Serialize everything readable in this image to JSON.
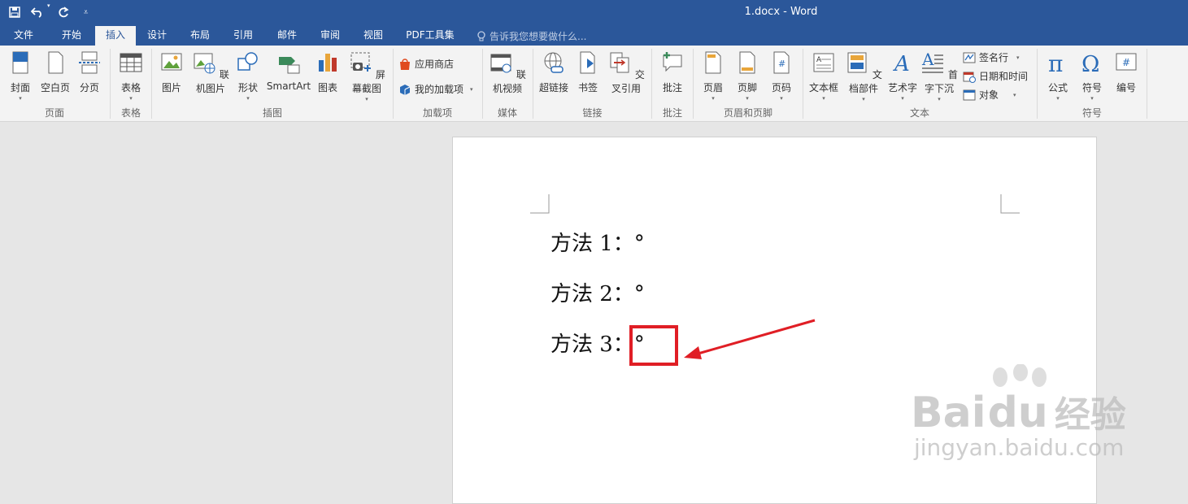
{
  "titlebar": {
    "doc_title": "1.docx - Word",
    "qat": [
      "save-icon",
      "undo-icon",
      "redo-icon",
      "customize-icon"
    ]
  },
  "tabs": [
    "文件",
    "开始",
    "插入",
    "设计",
    "布局",
    "引用",
    "邮件",
    "审阅",
    "视图",
    "PDF工具集"
  ],
  "active_tab": "插入",
  "tell_me": "告诉我您想要做什么...",
  "ribbon": {
    "groups": {
      "pages": "页面",
      "tables": "表格",
      "illustrations": "插图",
      "addins": "加载项",
      "media": "媒体",
      "links": "链接",
      "comments": "批注",
      "header_footer": "页眉和页脚",
      "text": "文本",
      "symbols": "符号"
    },
    "buttons": {
      "cover": "封面",
      "blank": "空白页",
      "pagebreak": "分页",
      "table": "表格",
      "picture": "图片",
      "online_picture": "联机图片",
      "shapes": "形状",
      "smartart": "SmartArt",
      "chart": "图表",
      "screenshot": "屏幕截图",
      "store": "应用商店",
      "my_addins": "我的加载项",
      "online_video": "联机视频",
      "hyperlink": "超链接",
      "bookmark": "书签",
      "cross_ref": "交叉引用",
      "comment": "批注",
      "header": "页眉",
      "footer": "页脚",
      "page_number": "页码",
      "textbox": "文本框",
      "quickparts": "文档部件",
      "wordart": "艺术字",
      "dropcap": "首字下沉",
      "signature": "签名行",
      "datetime": "日期和时间",
      "object": "对象",
      "equation": "公式",
      "symbol": "符号",
      "numbering": "编号"
    }
  },
  "document": {
    "lines": [
      "方法 1：°",
      "方法 2：°",
      "方法 3：°"
    ]
  },
  "annotation_color": "#e01e25",
  "watermark": {
    "brand": "Bai",
    "brand2": "du",
    "cn": "经验",
    "url": "jingyan.baidu.com"
  }
}
